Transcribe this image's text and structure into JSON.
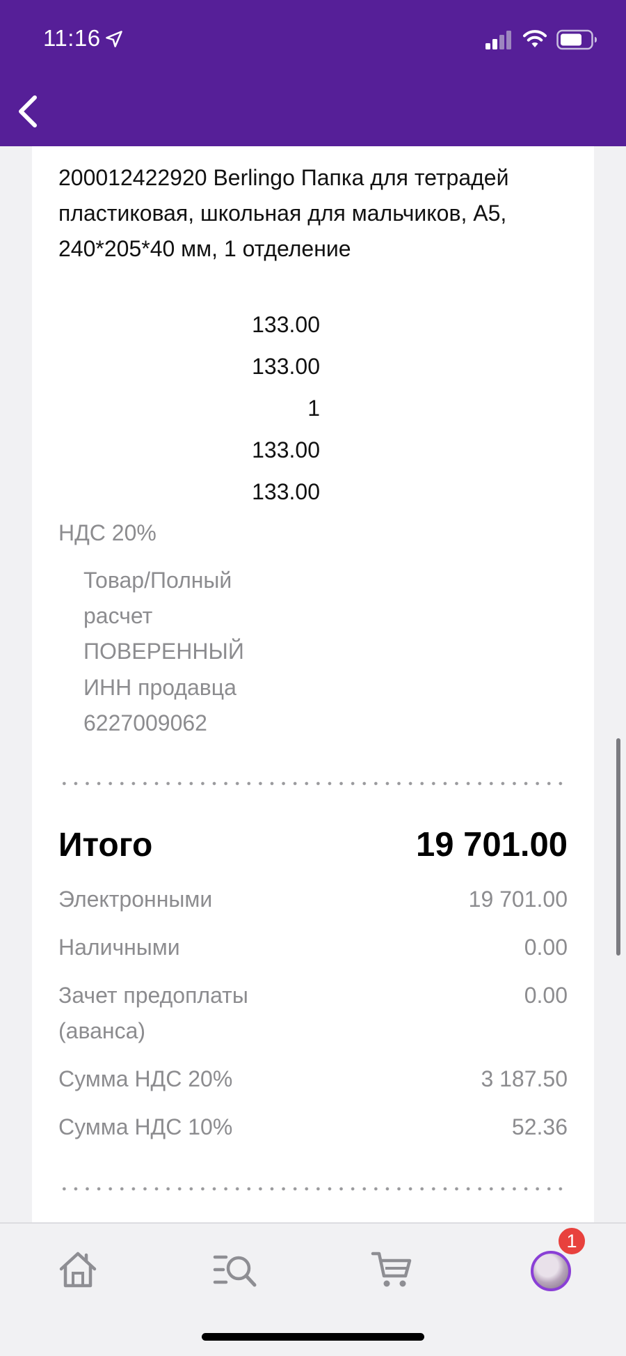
{
  "status_bar": {
    "time": "11:16"
  },
  "receipt": {
    "item_title": "200012422920 Berlingo Папка для тетрадей пластиковая, школьная для мальчиков, А5, 240*205*40 мм, 1 отделение",
    "price": "133.00",
    "price_discounted": "133.00",
    "quantity": "1",
    "amount": "133.00",
    "amount_total": "133.00",
    "vat_label": "НДС 20%",
    "item_type_line1": "Товар/Полный",
    "item_type_line2": "расчет",
    "agent": "ПОВЕРЕННЫЙ",
    "seller_inn_label": "ИНН продавца",
    "seller_inn": "6227009062",
    "total_label": "Итого",
    "total_value": "19 701.00",
    "payments": [
      {
        "label": "Электронными",
        "value": "19 701.00"
      },
      {
        "label": "Наличными",
        "value": "0.00"
      },
      {
        "label": "Зачет предоплаты (аванса)",
        "value": "0.00"
      },
      {
        "label": "Сумма НДС 20%",
        "value": "3 187.50"
      },
      {
        "label": "Сумма НДС 10%",
        "value": "52.36"
      }
    ]
  },
  "tabbar": {
    "icons": [
      "home-icon",
      "search-icon",
      "cart-icon",
      "avatar"
    ],
    "profile_badge": "1"
  },
  "colors": {
    "header": "#561f98",
    "badge": "#e8413d",
    "avatar_ring": "#8a3fd6"
  }
}
